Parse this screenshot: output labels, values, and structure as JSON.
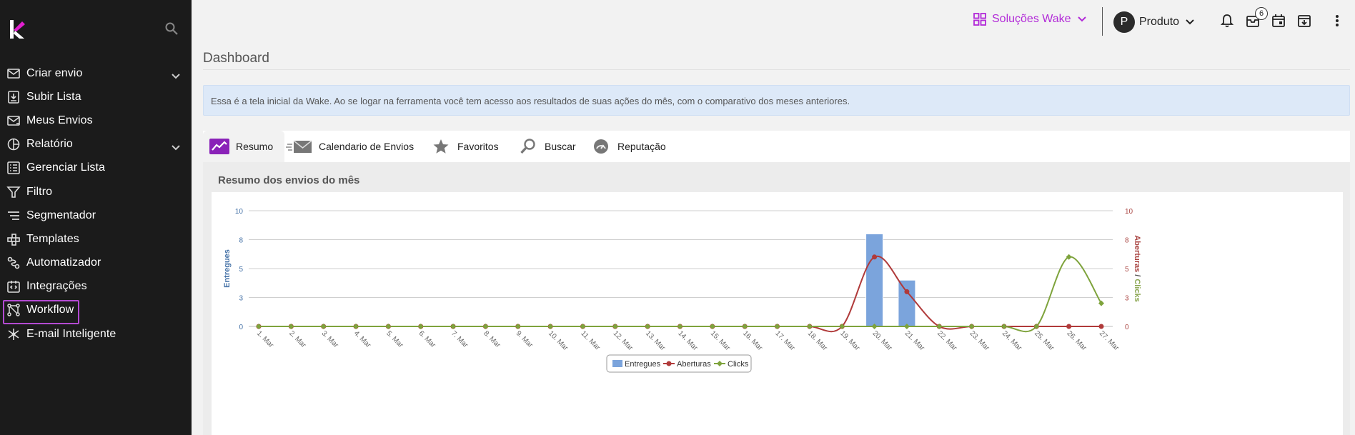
{
  "sidebar": {
    "items": [
      {
        "label": "Criar envio",
        "icon": "mail-icon",
        "expandable": true
      },
      {
        "label": "Subir Lista",
        "icon": "upload-list-icon",
        "expandable": false
      },
      {
        "label": "Meus Envios",
        "icon": "sent-mail-icon",
        "expandable": false
      },
      {
        "label": "Relatório",
        "icon": "pie-chart-icon",
        "expandable": true
      },
      {
        "label": "Gerenciar Lista",
        "icon": "list-icon",
        "expandable": false
      },
      {
        "label": "Filtro",
        "icon": "filter-icon",
        "expandable": false
      },
      {
        "label": "Segmentador",
        "icon": "segment-icon",
        "expandable": false
      },
      {
        "label": "Templates",
        "icon": "templates-icon",
        "expandable": false
      },
      {
        "label": "Automatizador",
        "icon": "automation-icon",
        "expandable": false
      },
      {
        "label": "Integrações",
        "icon": "integrations-icon",
        "expandable": false
      },
      {
        "label": "Workflow",
        "icon": "workflow-icon",
        "expandable": false,
        "active": true
      },
      {
        "label": "E-mail Inteligente",
        "icon": "smart-email-icon",
        "expandable": false
      }
    ]
  },
  "topbar": {
    "solucoes_label": "Soluções Wake",
    "user_initial": "P",
    "product_label": "Produto",
    "notifications_count": "6"
  },
  "page": {
    "title": "Dashboard",
    "info_text": "Essa é a tela inicial da Wake. Ao se logar na ferramenta você tem acesso aos resultados de suas ações do mês, com o comparativo dos meses anteriores."
  },
  "tabs": [
    {
      "label": "Resumo",
      "active": true
    },
    {
      "label": "Calendario de Envios",
      "active": false
    },
    {
      "label": "Favoritos",
      "active": false
    },
    {
      "label": "Buscar",
      "active": false
    },
    {
      "label": "Reputação",
      "active": false
    }
  ],
  "panel": {
    "title": "Resumo dos envios do mês"
  },
  "colors": {
    "accent": "#b22ad8",
    "bar": "#7ba4dc",
    "aberturas": "#b03a3a",
    "clicks": "#7ea33c"
  },
  "chart_data": {
    "type": "bar",
    "categories": [
      "1. Mar",
      "2. Mar",
      "3. Mar",
      "4. Mar",
      "5. Mar",
      "6. Mar",
      "7. Mar",
      "8. Mar",
      "9. Mar",
      "10. Mar",
      "11. Mar",
      "12. Mar",
      "13. Mar",
      "14. Mar",
      "15. Mar",
      "16. Mar",
      "17. Mar",
      "18. Mar",
      "19. Mar",
      "20. Mar",
      "21. Mar",
      "22. Mar",
      "23. Mar",
      "24. Mar",
      "25. Mar",
      "26. Mar",
      "27. Mar"
    ],
    "ylabel_left": "Entregues",
    "ylabel_right_a": "Aberturas",
    "ylabel_right_sep": "/",
    "ylabel_right_b": "Clicks",
    "ylim": [
      0,
      10
    ],
    "yticks": [
      "0",
      "3",
      "5",
      "8",
      "10"
    ],
    "legend_position": "bottom",
    "series": [
      {
        "name": "Entregues",
        "kind": "bar",
        "axis": "left",
        "values": [
          0,
          0,
          0,
          0,
          0,
          0,
          0,
          0,
          0,
          0,
          0,
          0,
          0,
          0,
          0,
          0,
          0,
          0,
          0,
          8,
          4,
          0,
          0,
          0,
          0,
          0,
          0
        ]
      },
      {
        "name": "Aberturas",
        "kind": "line",
        "axis": "right",
        "values": [
          0,
          0,
          0,
          0,
          0,
          0,
          0,
          0,
          0,
          0,
          0,
          0,
          0,
          0,
          0,
          0,
          0,
          0,
          0,
          6,
          3,
          0,
          0,
          0,
          0,
          0,
          0
        ]
      },
      {
        "name": "Clicks",
        "kind": "line",
        "axis": "right",
        "values": [
          0,
          0,
          0,
          0,
          0,
          0,
          0,
          0,
          0,
          0,
          0,
          0,
          0,
          0,
          0,
          0,
          0,
          0,
          0,
          0,
          0,
          0,
          0,
          0,
          0,
          6,
          2
        ]
      }
    ]
  }
}
